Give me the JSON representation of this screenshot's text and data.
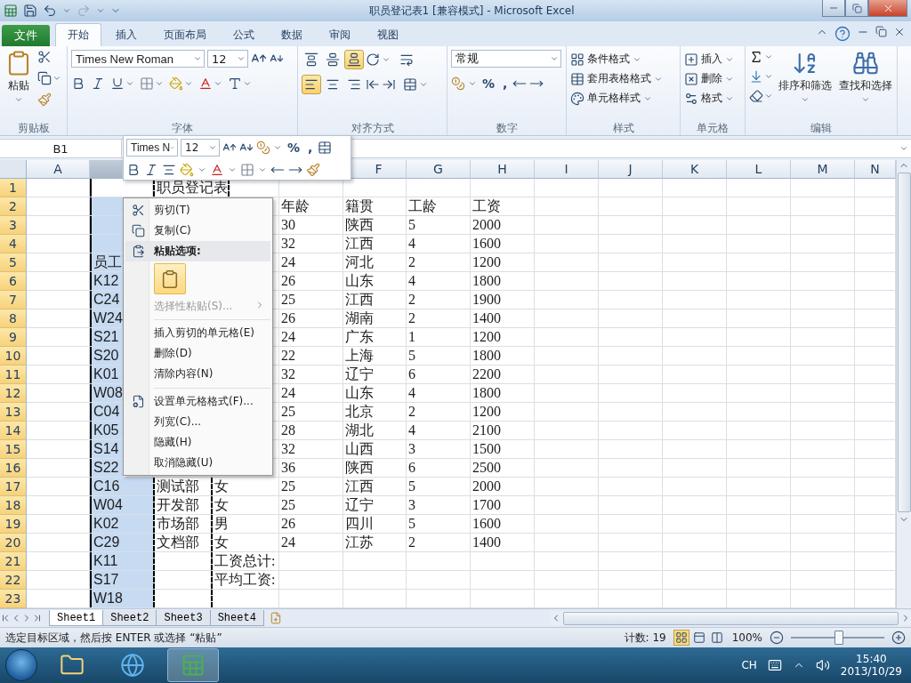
{
  "window": {
    "title": "职员登记表1  [兼容模式]  -  Microsoft Excel"
  },
  "file_tab": {
    "label": "文件"
  },
  "tabs": [
    {
      "label": "开始",
      "selected": true
    },
    {
      "label": "插入",
      "selected": false
    },
    {
      "label": "页面布局",
      "selected": false
    },
    {
      "label": "公式",
      "selected": false
    },
    {
      "label": "数据",
      "selected": false
    },
    {
      "label": "审阅",
      "selected": false
    },
    {
      "label": "视图",
      "selected": false
    }
  ],
  "ribbon": {
    "clipboard": {
      "paste_label": "粘贴",
      "group_label": "剪贴板"
    },
    "font": {
      "font_name": "Times New Roman",
      "font_size": "12",
      "group_label": "字体"
    },
    "alignment": {
      "vertical": [
        {
          "selected": false
        },
        {
          "selected": false
        },
        {
          "selected": true
        }
      ],
      "horizontal": [
        {
          "selected": true
        },
        {
          "selected": false
        },
        {
          "selected": false
        }
      ],
      "group_label": "对齐方式"
    },
    "number": {
      "format": "常规",
      "percent": "%",
      "comma": ",",
      "group_label": "数字"
    },
    "styles": {
      "items": [
        "条件格式",
        "套用表格格式",
        "单元格样式"
      ],
      "group_label": "样式"
    },
    "cells": {
      "items": [
        "插入",
        "删除",
        "格式"
      ],
      "group_label": "单元格"
    },
    "editing": {
      "buttons": [
        "排序和筛选",
        "查找和选择"
      ],
      "group_label": "编辑"
    }
  },
  "name_box": "B1",
  "mini_toolbar": {
    "font_name": "Times N",
    "font_size": "12",
    "percent": "%",
    "comma": ","
  },
  "columns": [
    {
      "label": "A",
      "selected": false
    },
    {
      "selected": true
    },
    null,
    null,
    null,
    {
      "label": "F",
      "selected": false
    },
    {
      "label": "G",
      "selected": false
    },
    {
      "label": "H",
      "selected": false
    },
    {
      "label": "I",
      "selected": false
    },
    {
      "label": "J",
      "selected": false
    },
    {
      "label": "K",
      "selected": false
    },
    {
      "label": "L",
      "selected": false
    },
    {
      "label": "M",
      "selected": false
    },
    {
      "label": "N",
      "selected": false
    }
  ],
  "rows": [
    {
      "number": "1",
      "selected": true,
      "cells": {
        "C": "职员登记表"
      }
    },
    {
      "number": "2",
      "selected": true,
      "cells": {
        "E": "年龄",
        "F": "籍贯",
        "G": "工龄",
        "H": "工资"
      }
    },
    {
      "number": "3",
      "selected": true,
      "cells": {
        "E": "30",
        "F": "陕西",
        "G": "5",
        "H": "2000"
      }
    },
    {
      "number": "4",
      "selected": true,
      "cells": {
        "E": "32",
        "F": "江西",
        "G": "4",
        "H": "1600"
      }
    },
    {
      "number": "5",
      "selected": true,
      "cells": {
        "B": "员工",
        "E": "24",
        "F": "河北",
        "G": "2",
        "H": "1200"
      }
    },
    {
      "number": "6",
      "selected": true,
      "cells": {
        "B": "K12",
        "E": "26",
        "F": "山东",
        "G": "4",
        "H": "1800"
      }
    },
    {
      "number": "7",
      "selected": true,
      "cells": {
        "B": "C24",
        "E": "25",
        "F": "江西",
        "G": "2",
        "H": "1900"
      }
    },
    {
      "number": "8",
      "selected": true,
      "cells": {
        "B": "W24",
        "E": "26",
        "F": "湖南",
        "G": "2",
        "H": "1400"
      }
    },
    {
      "number": "9",
      "selected": true,
      "cells": {
        "B": "S21",
        "E": "24",
        "F": "广东",
        "G": "1",
        "H": "1200"
      }
    },
    {
      "number": "10",
      "selected": true,
      "cells": {
        "B": "S20",
        "E": "22",
        "F": "上海",
        "G": "5",
        "H": "1800"
      }
    },
    {
      "number": "11",
      "selected": true,
      "cells": {
        "B": "K01",
        "E": "32",
        "F": "辽宁",
        "G": "6",
        "H": "2200"
      }
    },
    {
      "number": "12",
      "selected": true,
      "cells": {
        "B": "W08",
        "E": "24",
        "F": "山东",
        "G": "4",
        "H": "1800"
      }
    },
    {
      "number": "13",
      "selected": true,
      "cells": {
        "B": "C04",
        "E": "25",
        "F": "北京",
        "G": "2",
        "H": "1200"
      }
    },
    {
      "number": "14",
      "selected": true,
      "cells": {
        "B": "K05",
        "E": "28",
        "F": "湖北",
        "G": "4",
        "H": "2100"
      }
    },
    {
      "number": "15",
      "selected": true,
      "cells": {
        "B": "S14",
        "E": "32",
        "F": "山西",
        "G": "3",
        "H": "1500"
      }
    },
    {
      "number": "16",
      "selected": true,
      "cells": {
        "B": "S22",
        "E": "36",
        "F": "陕西",
        "G": "6",
        "H": "2500"
      }
    },
    {
      "number": "17",
      "selected": true,
      "cells": {
        "B": "C16",
        "C": "测试部",
        "D": "女",
        "E": "25",
        "F": "江西",
        "G": "5",
        "H": "2000"
      }
    },
    {
      "number": "18",
      "selected": true,
      "cells": {
        "B": "W04",
        "C": "开发部",
        "D": "女",
        "E": "25",
        "F": "辽宁",
        "G": "3",
        "H": "1700"
      }
    },
    {
      "number": "19",
      "selected": true,
      "cells": {
        "B": "K02",
        "C": "市场部",
        "D": "男",
        "E": "26",
        "F": "四川",
        "G": "5",
        "H": "1600"
      }
    },
    {
      "number": "20",
      "selected": true,
      "cells": {
        "B": "C29",
        "C": "文档部",
        "D": "女",
        "E": "24",
        "F": "江苏",
        "G": "2",
        "H": "1400"
      }
    },
    {
      "number": "21",
      "selected": true,
      "cells": {
        "B": "K11",
        "D": "工资总计:"
      }
    },
    {
      "number": "22",
      "selected": true,
      "cells": {
        "B": "S17",
        "D": "平均工资:"
      }
    },
    {
      "number": "23",
      "selected": true,
      "cells": {
        "B": "W18"
      }
    }
  ],
  "context_menu": {
    "items": [
      {
        "kind": "command",
        "label": "剪切(T)",
        "disabled": false
      },
      {
        "kind": "command",
        "label": "复制(C)",
        "disabled": false
      },
      {
        "kind": "heading",
        "label": "粘贴选项:"
      },
      {
        "kind": "paste-options"
      },
      {
        "kind": "submenu",
        "label": "选择性粘贴(S)...",
        "disabled": true
      },
      {
        "kind": "separator"
      },
      {
        "kind": "command",
        "label": "插入剪切的单元格(E)",
        "disabled": false
      },
      {
        "kind": "command",
        "label": "删除(D)",
        "disabled": false
      },
      {
        "kind": "command",
        "label": "清除内容(N)",
        "disabled": false
      },
      {
        "kind": "separator"
      },
      {
        "kind": "command",
        "label": "设置单元格格式(F)...",
        "disabled": false
      },
      {
        "kind": "command",
        "label": "列宽(C)...",
        "disabled": false
      },
      {
        "kind": "command",
        "label": "隐藏(H)",
        "disabled": false
      },
      {
        "kind": "command",
        "label": "取消隐藏(U)",
        "disabled": false
      }
    ]
  },
  "sheet_tabs": [
    {
      "label": "Sheet1",
      "selected": true
    },
    {
      "label": "Sheet2",
      "selected": false
    },
    {
      "label": "Sheet3",
      "selected": false
    },
    {
      "label": "Sheet4",
      "selected": false
    }
  ],
  "status_bar": {
    "message": "选定目标区域，然后按 ENTER 或选择 “粘贴”",
    "count": "计数: 19",
    "views": [
      {
        "selected": true
      },
      {
        "selected": false
      },
      {
        "selected": false
      }
    ],
    "zoom": "100%",
    "zoom_slider": {
      "level": 0.5
    }
  },
  "taskbar": {
    "apps": [
      {
        "kind": "folder",
        "selected": false
      },
      {
        "kind": "browser",
        "selected": false
      },
      {
        "kind": "spreadsheet",
        "selected": true
      }
    ],
    "language": "CH",
    "time": "15:40",
    "date": "2013/10/29"
  }
}
